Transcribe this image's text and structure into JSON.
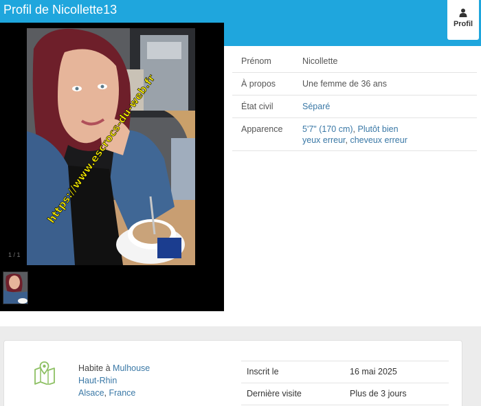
{
  "header": {
    "title": "Profil de Nicollette13",
    "profil_tab_label": "Profil"
  },
  "gallery": {
    "counter": "1 / 1",
    "watermark": "https://www.escrocs-du-web.fr"
  },
  "details": {
    "rows": [
      {
        "label": "Prénom",
        "value": "Nicollette"
      },
      {
        "label": "À propos",
        "value": "Une femme de 36 ans"
      },
      {
        "label": "État civil",
        "value": "Séparé"
      },
      {
        "label": "Apparence",
        "height": "5'7\" (170 cm)",
        "build": "Plutôt bien",
        "eyes": "yeux erreur",
        "hair": "cheveux erreur"
      }
    ]
  },
  "location": {
    "prefix": "Habite à",
    "city": "Mulhouse",
    "department": "Haut-Rhin",
    "region": "Alsace",
    "country": "France"
  },
  "stats": [
    {
      "label": "Inscrit le",
      "value": "16 mai 2025"
    },
    {
      "label": "Dernière visite",
      "value": "Plus de 3 jours"
    }
  ],
  "colors": {
    "header": "#1fa6dd",
    "link": "#3a78a6",
    "watermark": "#f2e600",
    "map_icon": "#8dc063"
  }
}
